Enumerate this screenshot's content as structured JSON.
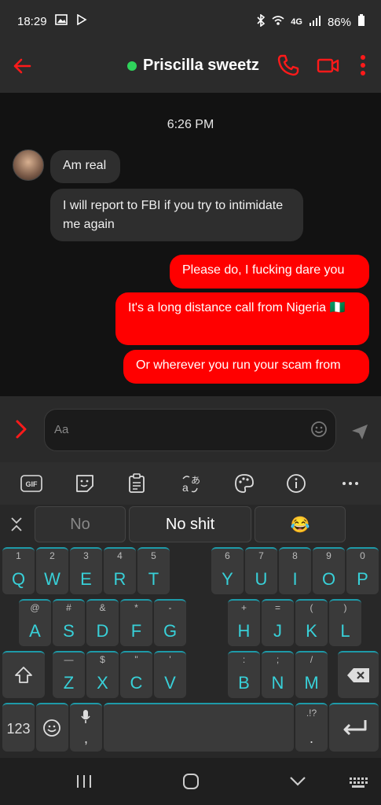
{
  "status": {
    "time": "18:29",
    "network": "4G",
    "battery": "86%"
  },
  "header": {
    "contact_name": "Priscilla sweetz"
  },
  "chat": {
    "timestamp": "6:26 PM",
    "messages": [
      {
        "dir": "in",
        "text": "Am real"
      },
      {
        "dir": "in",
        "text": "I will report to FBI if you try to intimidate me again"
      },
      {
        "dir": "out",
        "text": "Please do, I fucking dare you"
      },
      {
        "dir": "out",
        "text": "It's a long distance call from Nigeria 🇳🇬"
      },
      {
        "dir": "out",
        "text": "Or wherever you run your scam from"
      }
    ]
  },
  "composer": {
    "placeholder": "Aa"
  },
  "keyboard": {
    "toolbar": [
      "GIF",
      "sticker",
      "clipboard",
      "translate",
      "palette",
      "info",
      "more"
    ],
    "suggestions": [
      "No",
      "No shit",
      "😂"
    ],
    "row1": [
      [
        "1",
        "Q"
      ],
      [
        "2",
        "W"
      ],
      [
        "3",
        "E"
      ],
      [
        "4",
        "R"
      ],
      [
        "5",
        "T"
      ],
      [
        "6",
        "Y"
      ],
      [
        "7",
        "U"
      ],
      [
        "8",
        "I"
      ],
      [
        "9",
        "O"
      ],
      [
        "0",
        "P"
      ]
    ],
    "row2": [
      [
        "@",
        "A"
      ],
      [
        "#",
        "S"
      ],
      [
        "&",
        "D"
      ],
      [
        "*",
        "F"
      ],
      [
        "-",
        "G"
      ],
      [
        "+",
        "H"
      ],
      [
        "=",
        "J"
      ],
      [
        "(",
        "K"
      ],
      [
        ")",
        "L"
      ]
    ],
    "row3": [
      [
        "—",
        "Z"
      ],
      [
        "$",
        "X"
      ],
      [
        "\"",
        "C"
      ],
      [
        "'",
        "V"
      ],
      [
        ":",
        "B"
      ],
      [
        ";",
        "N"
      ],
      [
        "/",
        "M"
      ]
    ],
    "numbers_label": "123",
    "punct_label": ".!?",
    "comma_label": ","
  },
  "colors": {
    "accent": "#ff0000",
    "key_text": "#38d0d8",
    "online": "#2fd35b"
  }
}
